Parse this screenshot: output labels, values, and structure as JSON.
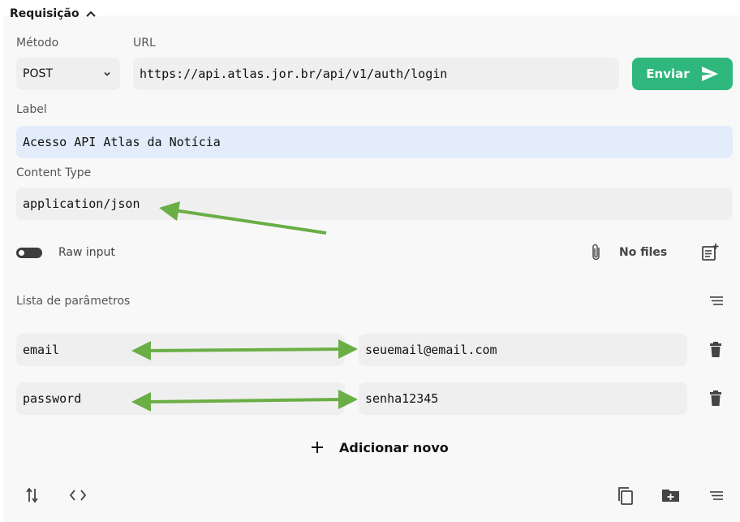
{
  "section": {
    "title": "Requisição",
    "toggle_icon": "chevron-up-icon"
  },
  "method": {
    "label": "Método",
    "value": "POST"
  },
  "url": {
    "label": "URL",
    "value": "https://api.atlas.jor.br/api/v1/auth/login"
  },
  "send": {
    "label": "Enviar",
    "icon": "send-icon"
  },
  "request_label": {
    "label": "Label",
    "value": "Acesso API Atlas da Notícia"
  },
  "content_type": {
    "label": "Content Type",
    "value": "application/json"
  },
  "raw_input": {
    "label": "Raw input",
    "enabled": false
  },
  "files": {
    "label": "No files",
    "icon": "paperclip-icon"
  },
  "params": {
    "title": "Lista de parâmetros",
    "rows": [
      {
        "key": "email",
        "value": "seuemail@email.com"
      },
      {
        "key": "password",
        "value": "senha12345"
      }
    ],
    "add_label": "Adicionar novo"
  },
  "colors": {
    "accent": "#2fb77e",
    "annotation_arrow": "#6aae45",
    "label_field": "#e3ecfa"
  }
}
